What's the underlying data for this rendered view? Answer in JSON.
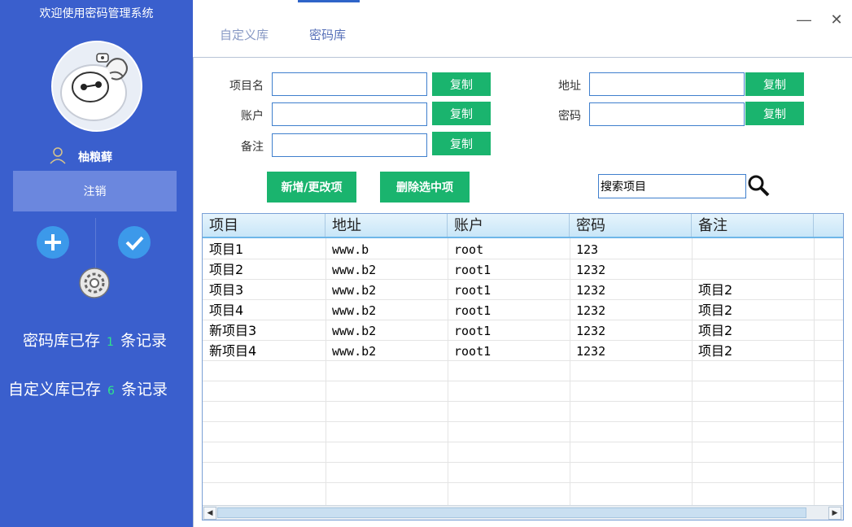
{
  "sidebar": {
    "title": "欢迎使用密码管理系统",
    "username": "柚粮藓",
    "logout_label": "注销",
    "stats": {
      "pwd_prefix": "密码库已存",
      "pwd_count": "1",
      "pwd_suffix": "条记录",
      "custom_prefix": "自定义库已存",
      "custom_count": "6",
      "custom_suffix": "条记录"
    },
    "colors": {
      "background": "#3a5fcd",
      "accent_count": "#2ee68a",
      "round_button": "#3c99ea"
    }
  },
  "tabs": [
    {
      "label": "自定义库"
    },
    {
      "label": "密码库",
      "active": true
    }
  ],
  "window_controls": {
    "minimize": "—",
    "close": "✕"
  },
  "form": {
    "project_label": "项目名",
    "address_label": "地址",
    "account_label": "账户",
    "password_label": "密码",
    "note_label": "备注",
    "copy_label": "复制",
    "project_value": "",
    "address_value": "",
    "account_value": "",
    "password_value": "",
    "note_value": ""
  },
  "actions": {
    "add_update": "新增/更改项",
    "delete_selected": "删除选中项",
    "search_value": "搜索项目"
  },
  "table": {
    "headers": [
      "项目",
      "地址",
      "账户",
      "密码",
      "备注"
    ],
    "rows": [
      [
        "项目1",
        "www.b",
        "root",
        "123",
        ""
      ],
      [
        "项目2",
        "www.b2",
        "root1",
        "1232",
        ""
      ],
      [
        "项目3",
        "www.b2",
        "root1",
        "1232",
        "项目2"
      ],
      [
        "项目4",
        "www.b2",
        "root1",
        "1232",
        "项目2"
      ],
      [
        "新项目3",
        "www.b2",
        "root1",
        "1232",
        "项目2"
      ],
      [
        "新项目4",
        "www.b2",
        "root1",
        "1232",
        "项目2"
      ]
    ]
  },
  "icons": [
    "user-icon",
    "plus-icon",
    "check-icon",
    "gear-icon",
    "search-icon",
    "avatar-robot"
  ],
  "colors": {
    "copy_button": "#1ab46e",
    "field_border": "#3f7fcd",
    "tab_active": "#2e64c8"
  }
}
